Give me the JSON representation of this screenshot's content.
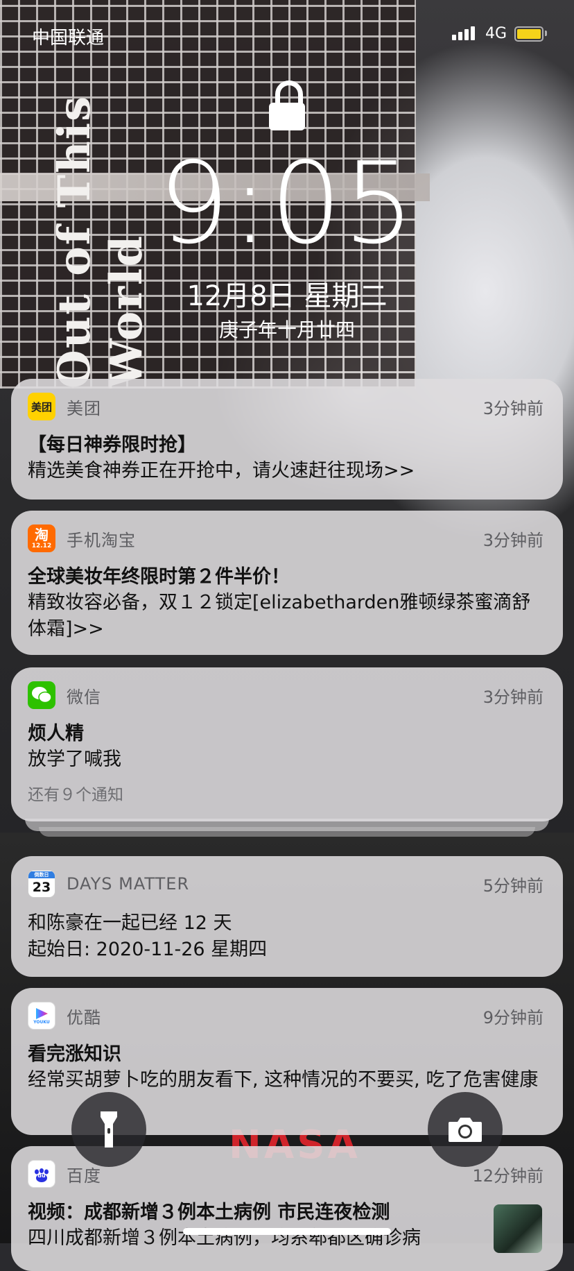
{
  "status_bar": {
    "carrier": "中国联通",
    "network": "4G",
    "signal_bars": 4,
    "battery_color": "#f5d31a"
  },
  "wallpaper": {
    "text": "Out of This World",
    "logo": "NASA"
  },
  "lock_screen": {
    "time": "9:05",
    "date": "12月8日 星期二",
    "lunar_date": "庚子年十月廿四",
    "lock_icon": "lock-icon"
  },
  "notifications": [
    {
      "app": "美团",
      "icon_label": "美团",
      "icon_color": "#ffd100",
      "time": "3分钟前",
      "title": "【每日神券限时抢】",
      "body": "精选美食神券正在开抢中，请火速赶往现场>>"
    },
    {
      "app": "手机淘宝",
      "icon_label": "淘",
      "icon_badge": "12.12",
      "icon_color": "#ff6a00",
      "time": "3分钟前",
      "title": "全球美妆年终限时第２件半价！",
      "body": "精致妆容必备，双１２锁定[elizabetharden雅顿绿茶蜜滴舒体霜]>>"
    },
    {
      "app": "微信",
      "icon_color": "#2dc100",
      "time": "3分钟前",
      "title": "烦人精",
      "body": "放学了喊我",
      "more": "还有９个通知"
    },
    {
      "app": "DAYS MATTER",
      "icon_label": "23",
      "icon_badge": "倒数日",
      "icon_color": "#ffffff",
      "time": "5分钟前",
      "title": "",
      "body": "和陈豪在一起已经 12 天",
      "body2": "起始日: 2020-11-26 星期四"
    },
    {
      "app": "优酷",
      "icon_label": "YOUKU",
      "icon_color": "#ffffff",
      "time": "9分钟前",
      "title": "看完涨知识",
      "body": "经常买胡萝卜吃的朋友看下, 这种情况的不要买, 吃了危害健康"
    },
    {
      "app": "百度",
      "icon_label": "du",
      "icon_color": "#ffffff",
      "time": "12分钟前",
      "title": "视频：成都新增３例本土病例 市民连夜检测",
      "body": "四川成都新增３例本土病例，均系郫都区确诊病"
    }
  ],
  "controls": {
    "flashlight": "flashlight-icon",
    "camera": "camera-icon"
  }
}
